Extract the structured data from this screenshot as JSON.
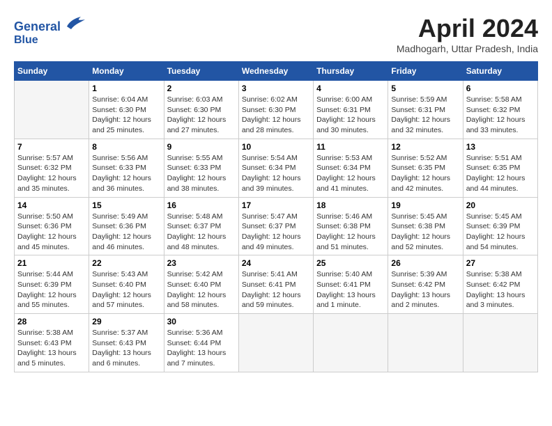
{
  "header": {
    "logo_line1": "General",
    "logo_line2": "Blue",
    "month_title": "April 2024",
    "subtitle": "Madhogarh, Uttar Pradesh, India"
  },
  "weekdays": [
    "Sunday",
    "Monday",
    "Tuesday",
    "Wednesday",
    "Thursday",
    "Friday",
    "Saturday"
  ],
  "weeks": [
    [
      {
        "day": "",
        "info": ""
      },
      {
        "day": "1",
        "info": "Sunrise: 6:04 AM\nSunset: 6:30 PM\nDaylight: 12 hours\nand 25 minutes."
      },
      {
        "day": "2",
        "info": "Sunrise: 6:03 AM\nSunset: 6:30 PM\nDaylight: 12 hours\nand 27 minutes."
      },
      {
        "day": "3",
        "info": "Sunrise: 6:02 AM\nSunset: 6:30 PM\nDaylight: 12 hours\nand 28 minutes."
      },
      {
        "day": "4",
        "info": "Sunrise: 6:00 AM\nSunset: 6:31 PM\nDaylight: 12 hours\nand 30 minutes."
      },
      {
        "day": "5",
        "info": "Sunrise: 5:59 AM\nSunset: 6:31 PM\nDaylight: 12 hours\nand 32 minutes."
      },
      {
        "day": "6",
        "info": "Sunrise: 5:58 AM\nSunset: 6:32 PM\nDaylight: 12 hours\nand 33 minutes."
      }
    ],
    [
      {
        "day": "7",
        "info": "Sunrise: 5:57 AM\nSunset: 6:32 PM\nDaylight: 12 hours\nand 35 minutes."
      },
      {
        "day": "8",
        "info": "Sunrise: 5:56 AM\nSunset: 6:33 PM\nDaylight: 12 hours\nand 36 minutes."
      },
      {
        "day": "9",
        "info": "Sunrise: 5:55 AM\nSunset: 6:33 PM\nDaylight: 12 hours\nand 38 minutes."
      },
      {
        "day": "10",
        "info": "Sunrise: 5:54 AM\nSunset: 6:34 PM\nDaylight: 12 hours\nand 39 minutes."
      },
      {
        "day": "11",
        "info": "Sunrise: 5:53 AM\nSunset: 6:34 PM\nDaylight: 12 hours\nand 41 minutes."
      },
      {
        "day": "12",
        "info": "Sunrise: 5:52 AM\nSunset: 6:35 PM\nDaylight: 12 hours\nand 42 minutes."
      },
      {
        "day": "13",
        "info": "Sunrise: 5:51 AM\nSunset: 6:35 PM\nDaylight: 12 hours\nand 44 minutes."
      }
    ],
    [
      {
        "day": "14",
        "info": "Sunrise: 5:50 AM\nSunset: 6:36 PM\nDaylight: 12 hours\nand 45 minutes."
      },
      {
        "day": "15",
        "info": "Sunrise: 5:49 AM\nSunset: 6:36 PM\nDaylight: 12 hours\nand 46 minutes."
      },
      {
        "day": "16",
        "info": "Sunrise: 5:48 AM\nSunset: 6:37 PM\nDaylight: 12 hours\nand 48 minutes."
      },
      {
        "day": "17",
        "info": "Sunrise: 5:47 AM\nSunset: 6:37 PM\nDaylight: 12 hours\nand 49 minutes."
      },
      {
        "day": "18",
        "info": "Sunrise: 5:46 AM\nSunset: 6:38 PM\nDaylight: 12 hours\nand 51 minutes."
      },
      {
        "day": "19",
        "info": "Sunrise: 5:45 AM\nSunset: 6:38 PM\nDaylight: 12 hours\nand 52 minutes."
      },
      {
        "day": "20",
        "info": "Sunrise: 5:45 AM\nSunset: 6:39 PM\nDaylight: 12 hours\nand 54 minutes."
      }
    ],
    [
      {
        "day": "21",
        "info": "Sunrise: 5:44 AM\nSunset: 6:39 PM\nDaylight: 12 hours\nand 55 minutes."
      },
      {
        "day": "22",
        "info": "Sunrise: 5:43 AM\nSunset: 6:40 PM\nDaylight: 12 hours\nand 57 minutes."
      },
      {
        "day": "23",
        "info": "Sunrise: 5:42 AM\nSunset: 6:40 PM\nDaylight: 12 hours\nand 58 minutes."
      },
      {
        "day": "24",
        "info": "Sunrise: 5:41 AM\nSunset: 6:41 PM\nDaylight: 12 hours\nand 59 minutes."
      },
      {
        "day": "25",
        "info": "Sunrise: 5:40 AM\nSunset: 6:41 PM\nDaylight: 13 hours\nand 1 minute."
      },
      {
        "day": "26",
        "info": "Sunrise: 5:39 AM\nSunset: 6:42 PM\nDaylight: 13 hours\nand 2 minutes."
      },
      {
        "day": "27",
        "info": "Sunrise: 5:38 AM\nSunset: 6:42 PM\nDaylight: 13 hours\nand 3 minutes."
      }
    ],
    [
      {
        "day": "28",
        "info": "Sunrise: 5:38 AM\nSunset: 6:43 PM\nDaylight: 13 hours\nand 5 minutes."
      },
      {
        "day": "29",
        "info": "Sunrise: 5:37 AM\nSunset: 6:43 PM\nDaylight: 13 hours\nand 6 minutes."
      },
      {
        "day": "30",
        "info": "Sunrise: 5:36 AM\nSunset: 6:44 PM\nDaylight: 13 hours\nand 7 minutes."
      },
      {
        "day": "",
        "info": ""
      },
      {
        "day": "",
        "info": ""
      },
      {
        "day": "",
        "info": ""
      },
      {
        "day": "",
        "info": ""
      }
    ]
  ]
}
